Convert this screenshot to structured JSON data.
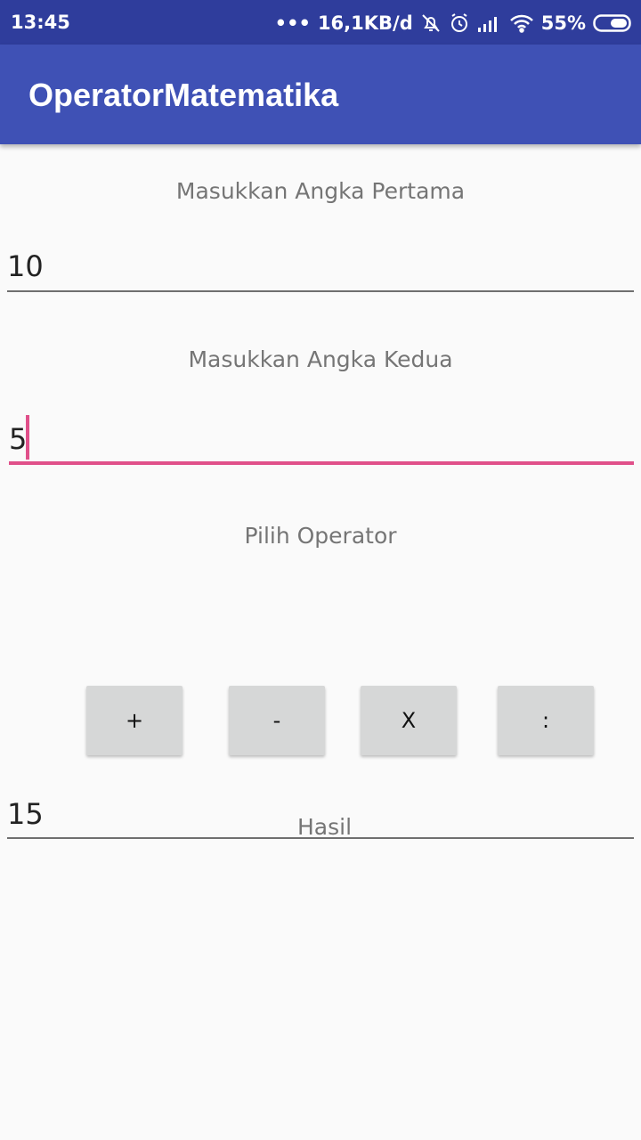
{
  "status_bar": {
    "time": "13:45",
    "dots": "•••",
    "network_speed": "16,1KB/d",
    "battery_percent": "55%",
    "icons": [
      "alarm-off-icon",
      "alarm-icon",
      "signal-icon",
      "wifi-icon",
      "battery-icon"
    ]
  },
  "app_bar": {
    "title": "OperatorMatematika",
    "color": "#3f51b5"
  },
  "form": {
    "first_label": "Masukkan Angka Pertama",
    "first_value": "10",
    "second_label": "Masukkan Angka Kedua",
    "second_value": "5",
    "operator_label": "Pilih Operator",
    "operators": {
      "add": "+",
      "subtract": "-",
      "multiply": "X",
      "divide": ":"
    },
    "result_value": "15",
    "result_hint": "Hasil"
  },
  "colors": {
    "accent": "#e0508a",
    "primary_dark": "#2f3d9c"
  }
}
